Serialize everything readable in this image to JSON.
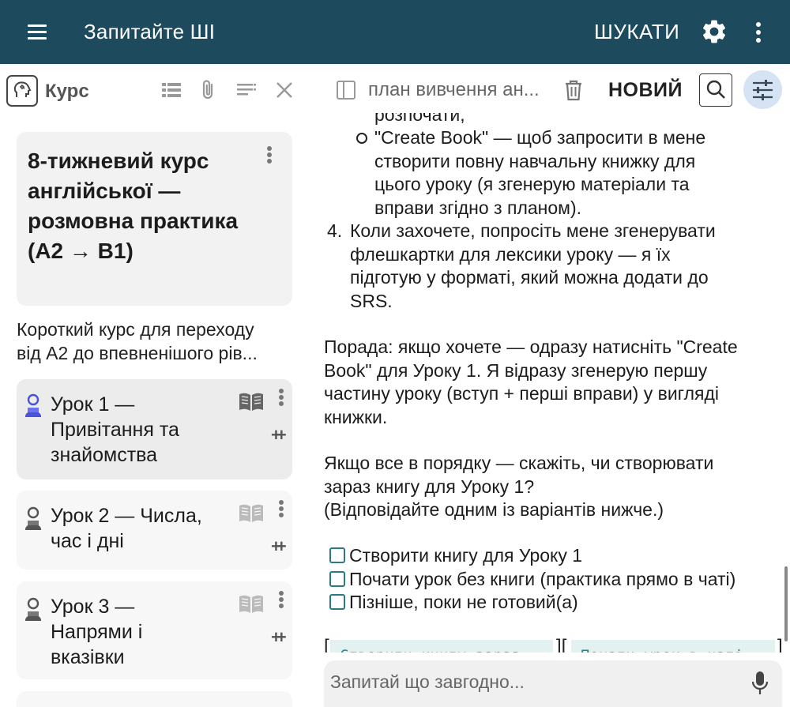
{
  "appbar": {
    "title": "Запитайте ШІ",
    "search_label": "ШУКАТИ",
    "menu_icon": "hamburger-menu-icon",
    "settings_icon": "gear-icon",
    "more_icon": "more-vertical-icon",
    "background_color": "#1d4a5c"
  },
  "left_panel": {
    "toolbar": {
      "label": "Курс",
      "icons": [
        "course-brain-icon",
        "list-icon",
        "paperclip-icon",
        "playlist-icon",
        "close-icon"
      ]
    },
    "course": {
      "title": "8-тижневий курс англійської — розмовна практика (A2 → B1)",
      "description_line1": "Короткий курс для переходу",
      "description_line2": "від A2 до впевненішого рів..."
    },
    "lessons": [
      {
        "line1": "Урок 1 —",
        "line2": "Привітання та",
        "line3": "знайомства",
        "active": true
      },
      {
        "line1": "Урок 2 — Числа,",
        "line2": "час і дні",
        "line3": "",
        "active": false
      },
      {
        "line1": "Урок 3 —",
        "line2": "Напрями і",
        "line3": "вказівки",
        "active": false
      }
    ],
    "plus_glyph": "++"
  },
  "right_panel": {
    "toolbar": {
      "chat_title": "план вивчення ан...",
      "new_label": "НОВИЙ",
      "accent_color": "#d5e3f5"
    },
    "message": {
      "l_top": "розпочати,",
      "l_cb1": "\"Create Book\" — щоб запросити в мене",
      "l_cb2": "створити повну навчальну книжку для",
      "l_cb3": "цього уроку (я згенерую матеріали та",
      "l_cb4": "вправи згідно з планом).",
      "n4": "4.",
      "l_4a": "Коли захочете, попросіть мене згенерувати",
      "l_4b": "флешкартки для лексики уроку — я їх",
      "l_4c": "підготую у форматі, який можна додати до",
      "l_4d": "SRS.",
      "tip1": "Порада: якщо хочете — одразу натисніть \"Create",
      "tip2": "Book\" для Уроку 1. Я відразу згенерую першу",
      "tip3": "частину уроку (вступ + перші вправи) у вигляді",
      "tip4": "книжки.",
      "q1": "Якщо все в порядку — скажіть, чи створювати",
      "q2": "зараз книгу для Уроку 1?",
      "q3": "(Відповідайте одним із варіантів нижче.)",
      "opt1": "Створити книгу для Уроку 1",
      "opt2": "Почати урок без книги (практика прямо в чаті)",
      "opt3": "Пізніше, поки не готовий(а)",
      "btn1": "Створити книгу зараз",
      "btn2": "Почати урок в чаті",
      "check_color": "#2a7a86"
    },
    "composer": {
      "placeholder": "Запитай що завгодно...",
      "mic_icon": "microphone-icon"
    }
  }
}
